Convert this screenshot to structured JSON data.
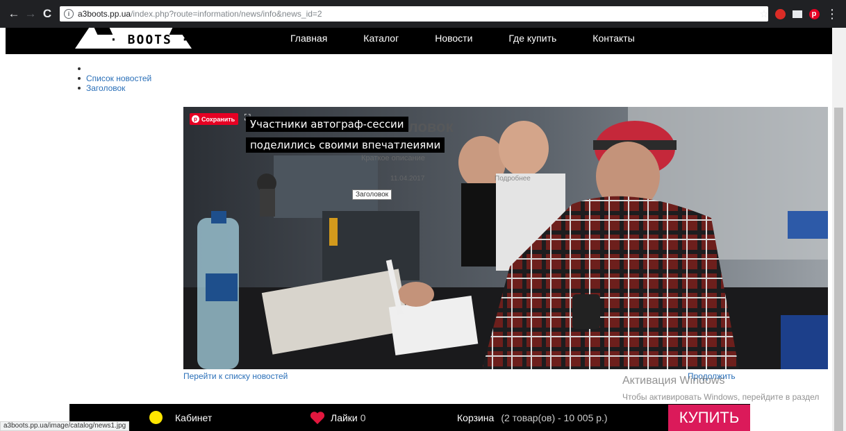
{
  "browser": {
    "url_host": "a3boots.pp.ua",
    "url_path": "/index.php?route=information/news/info&news_id=2",
    "status_url": "a3boots.pp.ua/image/catalog/news1.jpg"
  },
  "site": {
    "logo_text": "· BOOTS ·",
    "nav": [
      "Главная",
      "Каталог",
      "Новости",
      "Где купить",
      "Контакты"
    ]
  },
  "breadcrumb": {
    "items": [
      "Список новостей",
      "Заголовок"
    ]
  },
  "article": {
    "image_caption_line1": "Участники автограф-сессии",
    "image_caption_line2": "поделились своими впечатлеиями",
    "ghost_title": "Заголовок",
    "ghost_subtitle": "Краткое описание",
    "ghost_date": "11.04.2017",
    "ghost_more": "Подробнее",
    "tooltip": "Заголовок",
    "pin_save_label": "Сохранить",
    "back_link": "Перейти к списку новостей",
    "continue_link": "Продолжить"
  },
  "watermark": {
    "title": "Активация Windows",
    "text": "Чтобы активировать Windows, перейдите в раздел \"Параметры\"."
  },
  "bottom_bar": {
    "cabinet": "Кабинет",
    "likes_label": "Лайки",
    "likes_count": "0",
    "cart_label": "Корзина",
    "cart_summary": "(2 товар(ов) - 10 005 р.)",
    "buy_label": "КУПИТЬ"
  },
  "colors": {
    "link": "#2a6fb8",
    "buy_button": "#db1a5a",
    "pinterest": "#e60023",
    "cabinet_dot": "#ffe600"
  }
}
